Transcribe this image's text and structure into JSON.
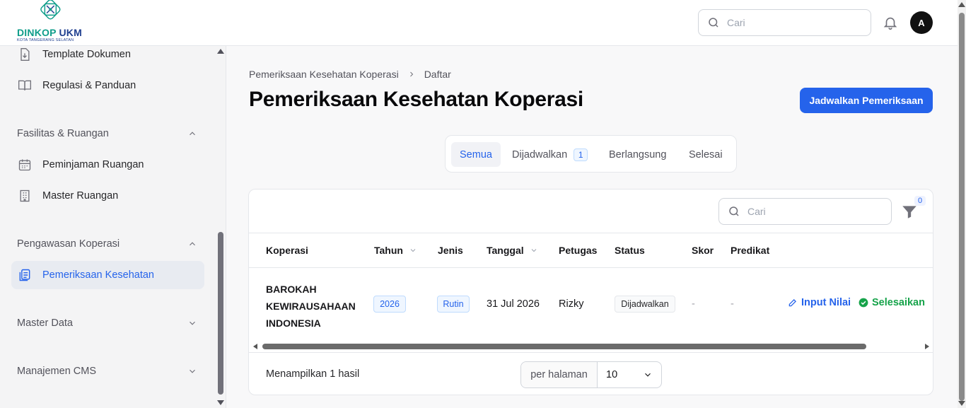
{
  "brand": {
    "name_part1": "DINKOP",
    "name_part2": "UKM",
    "subtitle": "KOTA TANGERANG SELATAN"
  },
  "topbar": {
    "search_placeholder": "Cari",
    "avatar_initial": "A"
  },
  "sidebar": {
    "items": [
      {
        "label": "Template Dokumen",
        "icon": "file-download-icon"
      },
      {
        "label": "Regulasi & Panduan",
        "icon": "book-icon"
      }
    ],
    "groups": [
      {
        "label": "Fasilitas & Ruangan",
        "expanded": true,
        "items": [
          {
            "label": "Peminjaman Ruangan",
            "icon": "calendar-icon"
          },
          {
            "label": "Master Ruangan",
            "icon": "building-icon"
          }
        ]
      },
      {
        "label": "Pengawasan Koperasi",
        "expanded": true,
        "items": [
          {
            "label": "Pemeriksaan Kesehatan",
            "icon": "clipboard-icon",
            "active": true
          }
        ]
      },
      {
        "label": "Master Data",
        "expanded": false
      },
      {
        "label": "Manajemen CMS",
        "expanded": false
      }
    ]
  },
  "breadcrumb": {
    "parent": "Pemeriksaan Kesehatan Koperasi",
    "current": "Daftar"
  },
  "page": {
    "title": "Pemeriksaan Kesehatan Koperasi",
    "primary_action": "Jadwalkan Pemeriksaan"
  },
  "tabs": [
    {
      "label": "Semua",
      "active": true
    },
    {
      "label": "Dijadwalkan",
      "count": "1"
    },
    {
      "label": "Berlangsung"
    },
    {
      "label": "Selesai"
    }
  ],
  "table": {
    "search_placeholder": "Cari",
    "filter_count": "0",
    "columns": [
      "Koperasi",
      "Tahun",
      "Jenis",
      "Tanggal",
      "Petugas",
      "Status",
      "Skor",
      "Predikat"
    ],
    "rows": [
      {
        "koperasi": "BAROKAH KEWIRAUSAHAAN INDONESIA",
        "tahun": "2026",
        "jenis": "Rutin",
        "tanggal": "31 Jul 2026",
        "petugas": "Rizky",
        "status": "Dijadwalkan",
        "skor": "-",
        "predikat": "-",
        "action_input": "Input Nilai",
        "action_finish": "Selesaikan"
      }
    ]
  },
  "footer": {
    "result_text": "Menampilkan 1 hasil",
    "per_page_label": "per halaman",
    "per_page_value": "10"
  },
  "colors": {
    "accent": "#2563eb",
    "success": "#16a34a",
    "brand_teal": "#0f9d8a",
    "brand_navy": "#1f3f8f"
  }
}
